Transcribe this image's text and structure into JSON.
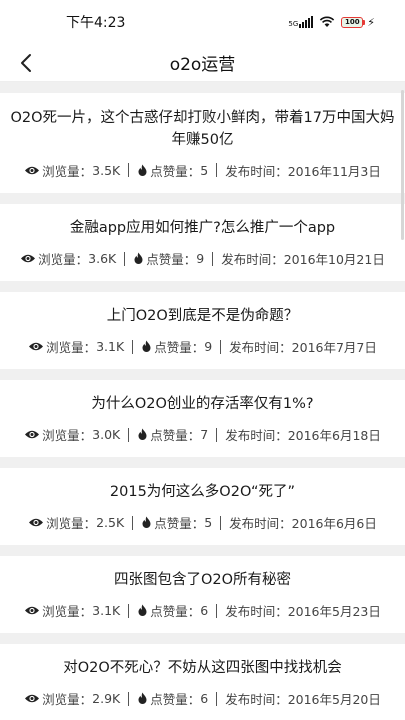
{
  "status_bar": {
    "time": "下午4:23",
    "network": "5G",
    "battery": "100"
  },
  "header": {
    "title": "o2o运营"
  },
  "meta_labels": {
    "views": "浏览量：",
    "likes": "点赞量：",
    "date": "发布时间："
  },
  "articles": [
    {
      "title": "O2O死一片，这个古惑仔却打败小鲜肉，带着17万中国大妈年赚50亿",
      "views": "3.5K",
      "likes": "5",
      "date": "2016年11月3日"
    },
    {
      "title": "金融app应用如何推广?怎么推广一个app",
      "views": "3.6K",
      "likes": "9",
      "date": "2016年10月21日"
    },
    {
      "title": "上门O2O到底是不是伪命题？",
      "views": "3.1K",
      "likes": "9",
      "date": "2016年7月7日"
    },
    {
      "title": "为什么O2O创业的存活率仅有1%?",
      "views": "3.0K",
      "likes": "7",
      "date": "2016年6月18日"
    },
    {
      "title": "2015为何这么多O2O“死了”",
      "views": "2.5K",
      "likes": "5",
      "date": "2016年6月6日"
    },
    {
      "title": "四张图包含了O2O所有秘密",
      "views": "3.1K",
      "likes": "6",
      "date": "2016年5月23日"
    },
    {
      "title": "对O2O不死心？不妨从这四张图中找找机会",
      "views": "2.9K",
      "likes": "6",
      "date": "2016年5月20日"
    }
  ]
}
